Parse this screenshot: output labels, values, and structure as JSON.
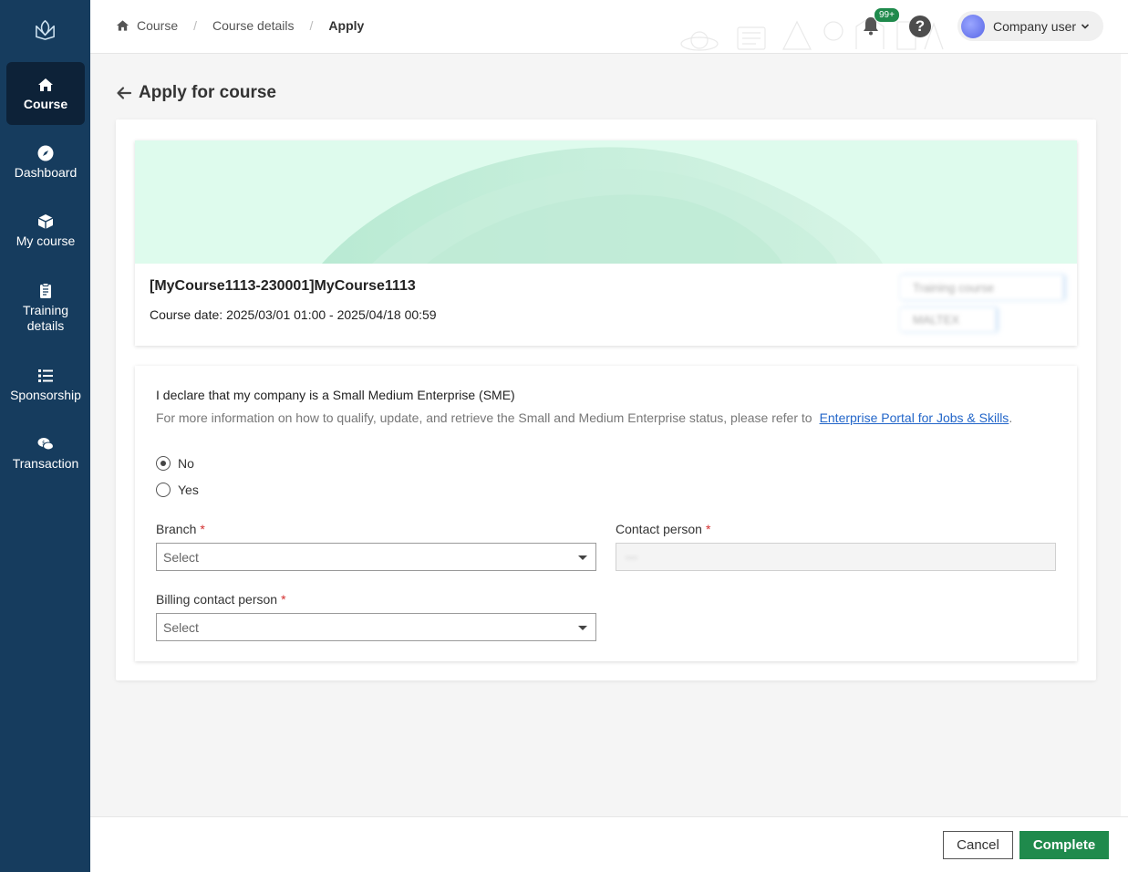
{
  "sidebar": {
    "logo_icon": "book-leaf-icon",
    "items": [
      {
        "label": "Course",
        "icon": "home-icon",
        "active": true
      },
      {
        "label": "Dashboard",
        "icon": "compass-icon",
        "active": false
      },
      {
        "label": "My course",
        "icon": "cube-icon",
        "active": false
      },
      {
        "label": "Training details",
        "icon": "clipboard-icon",
        "active": false
      },
      {
        "label": "Sponsorship",
        "icon": "list-icon",
        "active": false
      },
      {
        "label": "Transaction",
        "icon": "chat-money-icon",
        "active": false
      }
    ]
  },
  "header": {
    "breadcrumbs": [
      "Course",
      "Course details",
      "Apply"
    ],
    "notification_badge": "99+",
    "help_label": "?",
    "user_name": "Company user"
  },
  "page": {
    "title": "Apply for course"
  },
  "course": {
    "name": "[MyCourse1113-230001]MyCourse1113",
    "date_label": "Course date:",
    "date_value": "2025/03/01 01:00 - 2025/04/18 00:59",
    "tag1": "Training course",
    "tag2": "MALTEX"
  },
  "form": {
    "sme_title": "I declare that my company is a Small Medium Enterprise (SME)",
    "sme_info": "For more information on how to qualify, update, and retrieve the Small and Medium Enterprise status, please refer to",
    "sme_link": "Enterprise Portal for Jobs & Skills",
    "sme_options": [
      {
        "label": "No",
        "selected": true
      },
      {
        "label": "Yes",
        "selected": false
      }
    ],
    "branch_label": "Branch",
    "branch_placeholder": "Select",
    "contact_label": "Contact person",
    "contact_value": "—",
    "billing_label": "Billing contact person",
    "billing_placeholder": "Select",
    "required_mark": "*"
  },
  "footer": {
    "cancel_label": "Cancel",
    "complete_label": "Complete"
  },
  "colors": {
    "sidebar_bg": "#163c5e",
    "sidebar_active": "#0d2238",
    "primary_green": "#1f8a4c",
    "link_blue": "#2366c9",
    "required_red": "#d32f2f"
  }
}
